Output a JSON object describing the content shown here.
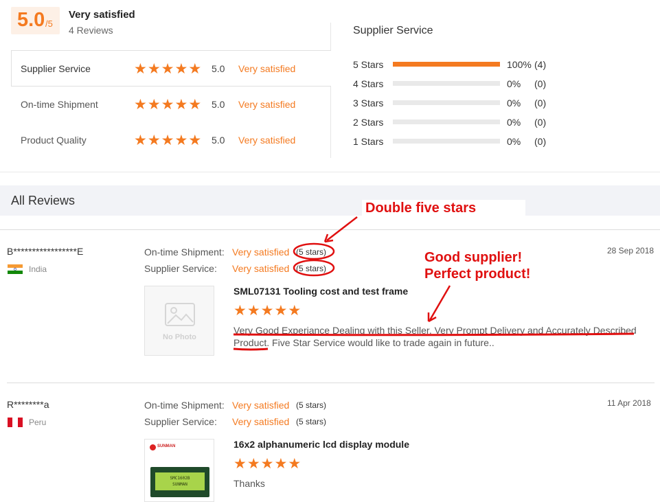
{
  "summary": {
    "score": "5.0",
    "score_den": "/5",
    "overall_label": "Very satisfied",
    "review_count": "4 Reviews",
    "metrics": [
      {
        "name": "Supplier Service",
        "score": "5.0",
        "text": "Very satisfied",
        "stars": 5
      },
      {
        "name": "On-time Shipment",
        "score": "5.0",
        "text": "Very satisfied",
        "stars": 5
      },
      {
        "name": "Product Quality",
        "score": "5.0",
        "text": "Very satisfied",
        "stars": 5
      }
    ]
  },
  "distribution": {
    "title": "Supplier Service",
    "rows": [
      {
        "label": "5 Stars",
        "pct": "100%",
        "count": "(4)",
        "fraction": 1.0
      },
      {
        "label": "4 Stars",
        "pct": "0%",
        "count": "(0)",
        "fraction": 0
      },
      {
        "label": "3 Stars",
        "pct": "0%",
        "count": "(0)",
        "fraction": 0
      },
      {
        "label": "2 Stars",
        "pct": "0%",
        "count": "(0)",
        "fraction": 0
      },
      {
        "label": "1 Stars",
        "pct": "0%",
        "count": "(0)",
        "fraction": 0
      }
    ]
  },
  "all_reviews_title": "All Reviews",
  "reviews": [
    {
      "buyer": "B*****************E",
      "country": "India",
      "date": "28 Sep 2018",
      "shipment_label": "On-time Shipment:",
      "shipment_value": "Very satisfied",
      "shipment_paren": "(5 stars)",
      "service_label": "Supplier Service:",
      "service_value": "Very satisfied",
      "service_paren": "(5 stars)",
      "product": "SML07131 Tooling cost and test frame",
      "stars": 5,
      "comment_line1": "Very Good Experiance Dealing with this Seller. Very Prompt Delivery and Accurately Described",
      "comment_line2_a": "Product",
      "comment_line2_b": ". Five Star Service would like to trade again in future..",
      "image_text": "No Photo"
    },
    {
      "buyer": "R********a",
      "country": "Peru",
      "date": "11 Apr 2018",
      "shipment_label": "On-time Shipment:",
      "shipment_value": "Very satisfied",
      "shipment_paren": "(5 stars)",
      "service_label": "Supplier Service:",
      "service_value": "Very satisfied",
      "service_paren": "(5 stars)",
      "product": "16x2 alphanumeric lcd display module",
      "stars": 5,
      "comment": "Thanks",
      "thumb_brand": "SUNMAN",
      "thumb_lcd_line1": "SMC1602B",
      "thumb_lcd_line2": "SUNMAN"
    }
  ],
  "annotations": {
    "double_five": "Double five stars",
    "good_supplier": "Good supplier!",
    "perfect_product": "Perfect product!"
  },
  "colors": {
    "accent": "#f47a20",
    "annotation": "#e01010"
  },
  "icons": {
    "star": "star-icon",
    "no_photo": "image-placeholder-icon",
    "flag_india": "india-flag-icon",
    "flag_peru": "peru-flag-icon"
  }
}
